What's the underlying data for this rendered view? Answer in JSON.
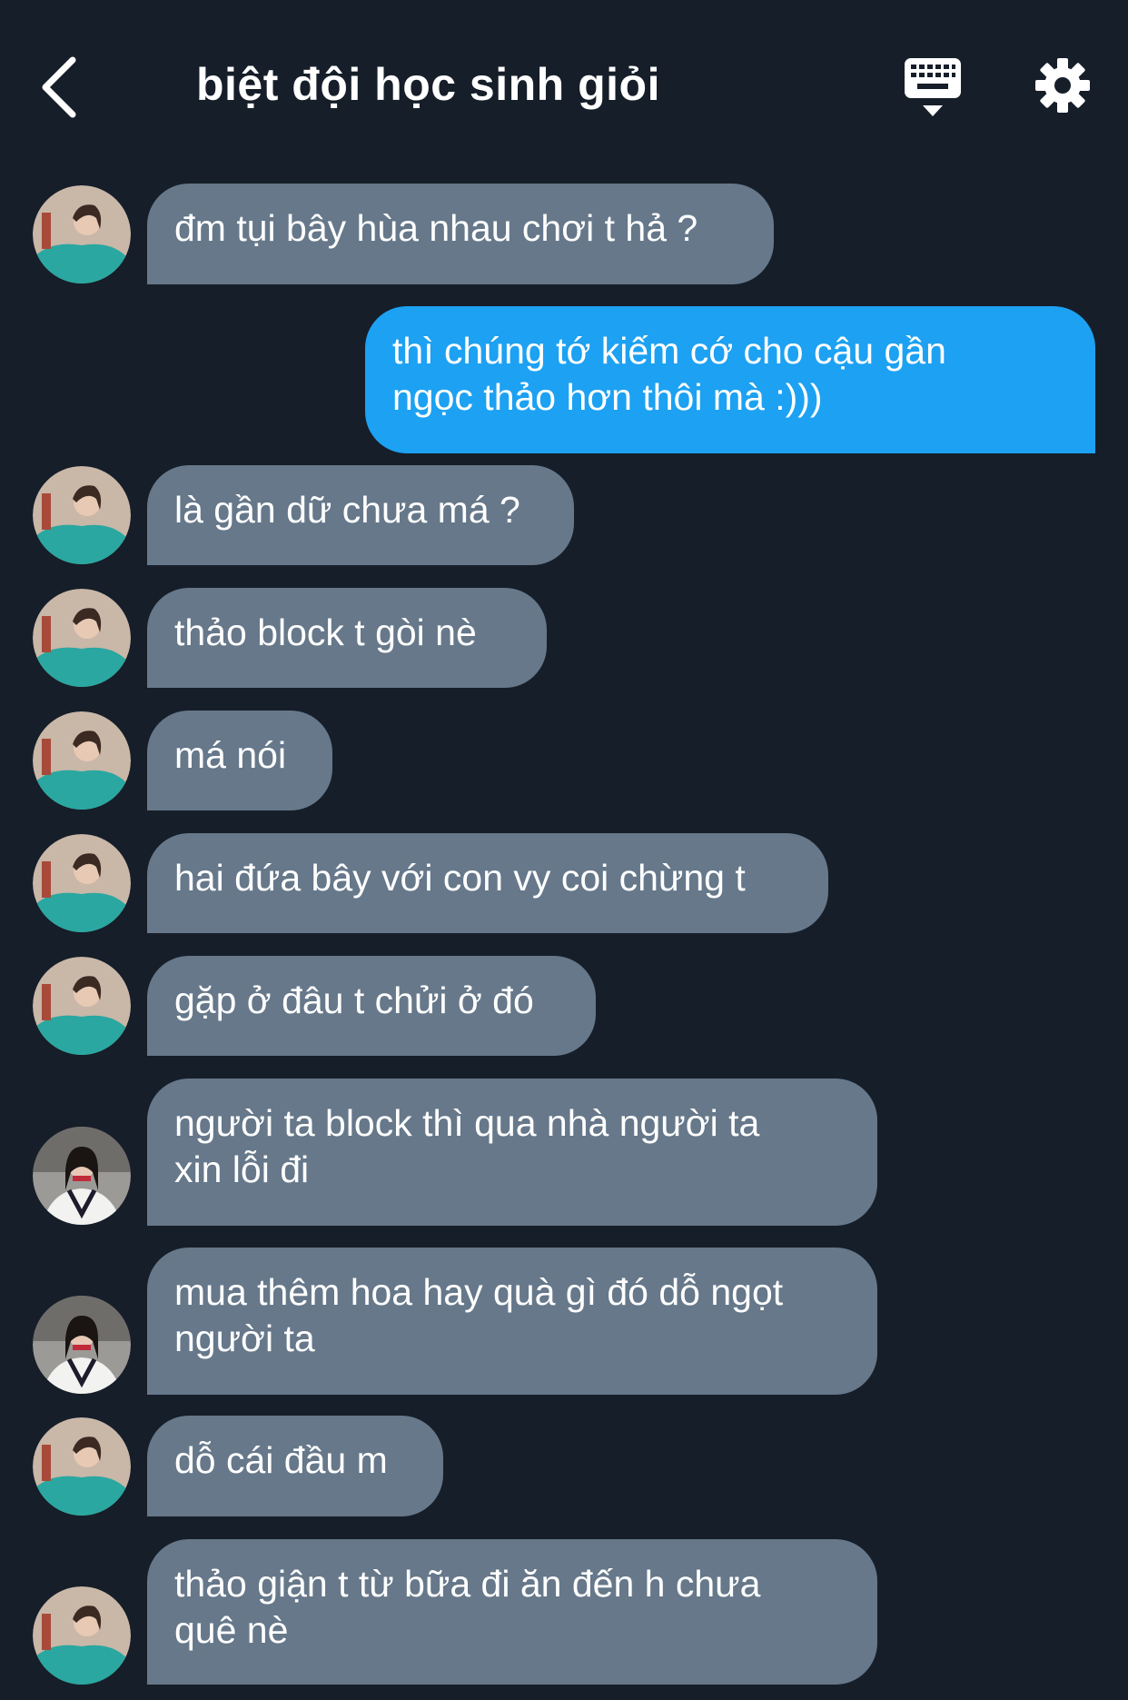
{
  "header": {
    "title": "biệt đội học sinh giỏi",
    "back_icon": "chevron-left-icon",
    "keyboard_icon": "keyboard-icon",
    "settings_icon": "gear-icon"
  },
  "colors": {
    "background": "#161e29",
    "incoming_bubble": "#66788a",
    "outgoing_bubble": "#1da1f2",
    "text": "#ffffff"
  },
  "messages": [
    {
      "sender": "friend_a",
      "direction": "incoming",
      "lines": [
        "đm tụi bây hùa nhau chơi t hả ?"
      ]
    },
    {
      "sender": "me",
      "direction": "outgoing",
      "lines": [
        "thì chúng tớ kiếm cớ cho cậu gần",
        "ngọc thảo hơn thôi mà :)))"
      ]
    },
    {
      "sender": "friend_a",
      "direction": "incoming",
      "lines": [
        "là gần dữ chưa má ?"
      ]
    },
    {
      "sender": "friend_a",
      "direction": "incoming",
      "lines": [
        "thảo block t gòi nè"
      ]
    },
    {
      "sender": "friend_a",
      "direction": "incoming",
      "lines": [
        "má nói"
      ]
    },
    {
      "sender": "friend_a",
      "direction": "incoming",
      "lines": [
        "hai đứa bây với con vy coi chừng t"
      ]
    },
    {
      "sender": "friend_a",
      "direction": "incoming",
      "lines": [
        "gặp ở đâu t chửi ở đó"
      ]
    },
    {
      "sender": "friend_b",
      "direction": "incoming",
      "lines": [
        "người ta block thì qua nhà người ta",
        "xin lỗi đi"
      ]
    },
    {
      "sender": "friend_b",
      "direction": "incoming",
      "lines": [
        "mua thêm hoa hay quà gì đó dỗ ngọt",
        "người ta"
      ]
    },
    {
      "sender": "friend_a",
      "direction": "incoming",
      "lines": [
        "dỗ cái đầu m"
      ]
    },
    {
      "sender": "friend_a",
      "direction": "incoming",
      "lines": [
        "thảo giận t từ bữa đi ăn đến h chưa",
        "quê nè"
      ]
    }
  ]
}
